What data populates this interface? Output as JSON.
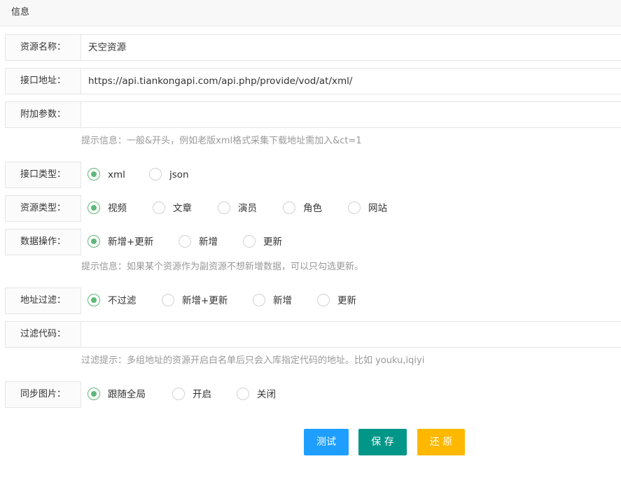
{
  "header": {
    "title": "信息"
  },
  "fields": {
    "name": {
      "label": "资源名称：",
      "value": "天空资源"
    },
    "api_url": {
      "label": "接口地址：",
      "value": "https://api.tiankongapi.com/api.php/provide/vod/at/xml/"
    },
    "params": {
      "label": "附加参数：",
      "value": ""
    },
    "params_tip": "提示信息：一般&开头，例如老版xml格式采集下载地址需加入&ct=1",
    "api_type": {
      "label": "接口类型：",
      "options": [
        "xml",
        "json"
      ],
      "selected": "xml"
    },
    "res_type": {
      "label": "资源类型：",
      "options": [
        "视频",
        "文章",
        "演员",
        "角色",
        "网站"
      ],
      "selected": "视频"
    },
    "data_op": {
      "label": "数据操作：",
      "options": [
        "新增+更新",
        "新增",
        "更新"
      ],
      "selected": "新增+更新"
    },
    "data_op_tip": "提示信息：如果某个资源作为副资源不想新增数据，可以只勾选更新。",
    "addr_filter": {
      "label": "地址过滤：",
      "options": [
        "不过滤",
        "新增+更新",
        "新增",
        "更新"
      ],
      "selected": "不过滤"
    },
    "filter_code": {
      "label": "过滤代码：",
      "value": ""
    },
    "filter_tip": "过滤提示：多组地址的资源开启白名单后只会入库指定代码的地址。比如 youku,iqiyi",
    "sync_pic": {
      "label": "同步图片：",
      "options": [
        "跟随全局",
        "开启",
        "关闭"
      ],
      "selected": "跟随全局"
    }
  },
  "buttons": {
    "test": "测试",
    "save": "保 存",
    "reset": "还 原"
  },
  "colors": {
    "radio_checked": "#5fb878",
    "test": "#1e9fff",
    "save": "#009688",
    "reset": "#ffb800"
  }
}
